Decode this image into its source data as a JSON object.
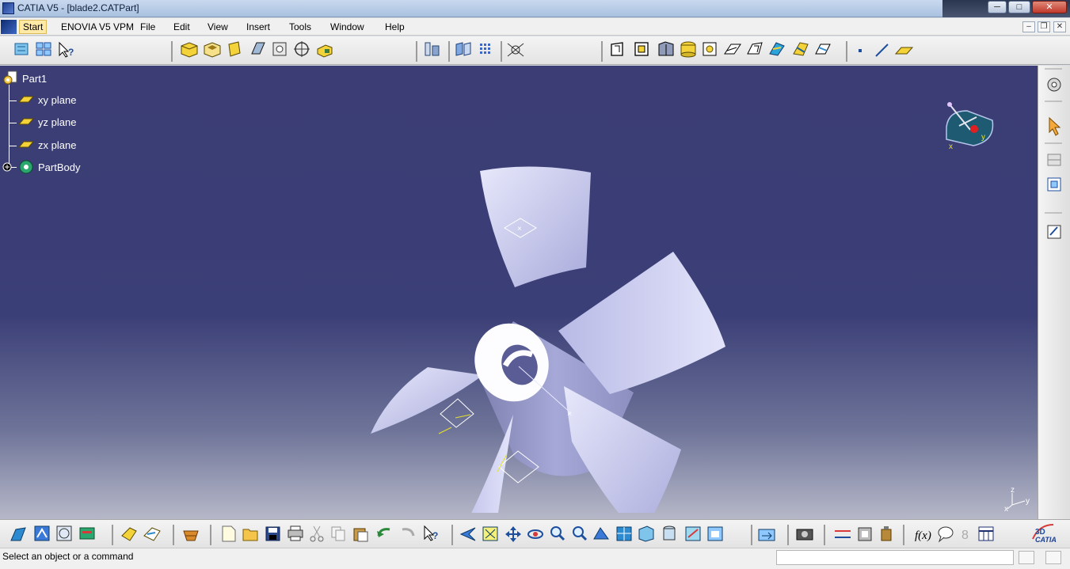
{
  "window": {
    "title": "CATIA V5 - [blade2.CATPart]",
    "minimize_glyph": "─",
    "maximize_glyph": "□",
    "close_glyph": "✕"
  },
  "menubar": {
    "items": [
      "Start",
      "ENOVIA V5 VPM",
      "File",
      "Edit",
      "View",
      "Insert",
      "Tools",
      "Window",
      "Help"
    ],
    "doc_minimize_glyph": "–",
    "doc_restore_glyph": "❐",
    "doc_close_glyph": "✕"
  },
  "tree": {
    "root": "Part1",
    "children": [
      "xy plane",
      "yz plane",
      "zx plane",
      "PartBody"
    ]
  },
  "compass": {
    "x_label": "x",
    "y_label": "y"
  },
  "axis_triad": {
    "z_label": "z",
    "y_label": "y",
    "x_label": "x"
  },
  "status": {
    "message": "Select an object or a command",
    "command_value": ""
  },
  "brand": {
    "label": "CATIA"
  },
  "colors": {
    "viewport_top": "#3b3d74",
    "part": "#c9cbf0",
    "tree_text": "#ffffff",
    "annotation": "#e6e12a"
  },
  "icons": {
    "top_toolbar": [
      "specification-tree-icon",
      "hide-show-icon",
      "whats-this-icon",
      "pad-icon",
      "pocket-icon",
      "shaft-icon",
      "groove-icon",
      "hole-icon",
      "rib-icon",
      "slot-icon",
      "stiffener-icon",
      "plane-system-icon",
      "measure-icon",
      "pattern-icon",
      "snap-icon",
      "fillet-icon",
      "chamfer-icon",
      "draft-icon",
      "shell-icon",
      "thickness-icon",
      "thread-icon",
      "remove-face-icon",
      "replace-face-icon",
      "split-icon",
      "thick-surface-icon",
      "close-surface-icon",
      "sew-surface-icon",
      "point-icon",
      "line-icon",
      "plane-icon"
    ],
    "right_toolbar": [
      "sketcher-icon",
      "select-icon",
      "boolean-icon",
      "assemble-icon",
      "annotation-icon"
    ],
    "bottom_toolbar": [
      "knowledge-icon",
      "constraint-icon",
      "analysis-icon",
      "update-icon",
      "catalog-icon",
      "publish-icon",
      "apply-material-icon",
      "new-icon",
      "open-icon",
      "save-icon",
      "print-icon",
      "cut-icon",
      "copy-icon",
      "paste-icon",
      "undo-icon",
      "redo-icon",
      "whats-this-icon",
      "fly-mode-icon",
      "fit-all-icon",
      "pan-icon",
      "rotate-icon",
      "zoom-in-icon",
      "zoom-out-icon",
      "normal-view-icon",
      "multi-view-icon",
      "iso-view-icon",
      "shading-icon",
      "hide-show-icon",
      "swap-space-icon",
      "capture-icon",
      "measure-between-icon",
      "measure-item-icon",
      "mass-icon",
      "formula-icon",
      "comment-icon",
      "rules-icon",
      "table-icon"
    ]
  }
}
